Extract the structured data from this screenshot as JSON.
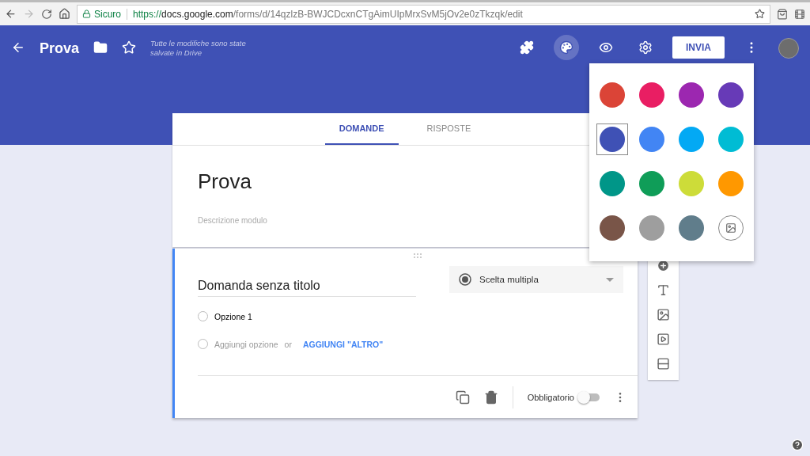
{
  "browser": {
    "security_label": "Sicuro",
    "url": {
      "scheme": "https://",
      "host": "docs.google.com",
      "path": "/forms/d/14qzlzB-BWJCDcxnCTgAimUIpMrxSvM5jOv2e0zTkzqk/edit"
    }
  },
  "header": {
    "title": "Prova",
    "save_status": "Tutte le modifiche sono state salvate in Drive",
    "send_button": "INVIA"
  },
  "tabs": [
    {
      "label": "DOMANDE",
      "selected": true
    },
    {
      "label": "RISPOSTE",
      "selected": false
    }
  ],
  "form": {
    "title": "Prova",
    "description_placeholder": "Descrizione modulo"
  },
  "question": {
    "title": "Domanda senza titolo",
    "type": "Scelta multipla",
    "options": [
      {
        "label": "Opzione 1",
        "selected": false
      }
    ],
    "add_option": "Aggiungi opzione",
    "add_option_selected": false,
    "or": "or",
    "add_other": "AGGIUNGI \"ALTRO\"",
    "required_label": "Obbligatorio",
    "required": false
  },
  "palette": [
    {
      "kind": "color",
      "color": "#db4437",
      "selected": false
    },
    {
      "kind": "color",
      "color": "#e91e63",
      "selected": false
    },
    {
      "kind": "color",
      "color": "#9c27b0",
      "selected": false
    },
    {
      "kind": "color",
      "color": "#673ab7",
      "selected": false
    },
    {
      "kind": "color",
      "color": "#3f51b5",
      "selected": true
    },
    {
      "kind": "color",
      "color": "#4285f4",
      "selected": false
    },
    {
      "kind": "color",
      "color": "#03a9f4",
      "selected": false
    },
    {
      "kind": "color",
      "color": "#00bcd4",
      "selected": false
    },
    {
      "kind": "color",
      "color": "#009688",
      "selected": false
    },
    {
      "kind": "color",
      "color": "#0f9d58",
      "selected": false
    },
    {
      "kind": "color",
      "color": "#cddc39",
      "selected": false
    },
    {
      "kind": "color",
      "color": "#ff9800",
      "selected": false
    },
    {
      "kind": "color",
      "color": "#795548",
      "selected": false
    },
    {
      "kind": "color",
      "color": "#9e9e9e",
      "selected": false
    },
    {
      "kind": "color",
      "color": "#607d8b",
      "selected": false
    },
    {
      "kind": "image",
      "selected": false
    }
  ]
}
